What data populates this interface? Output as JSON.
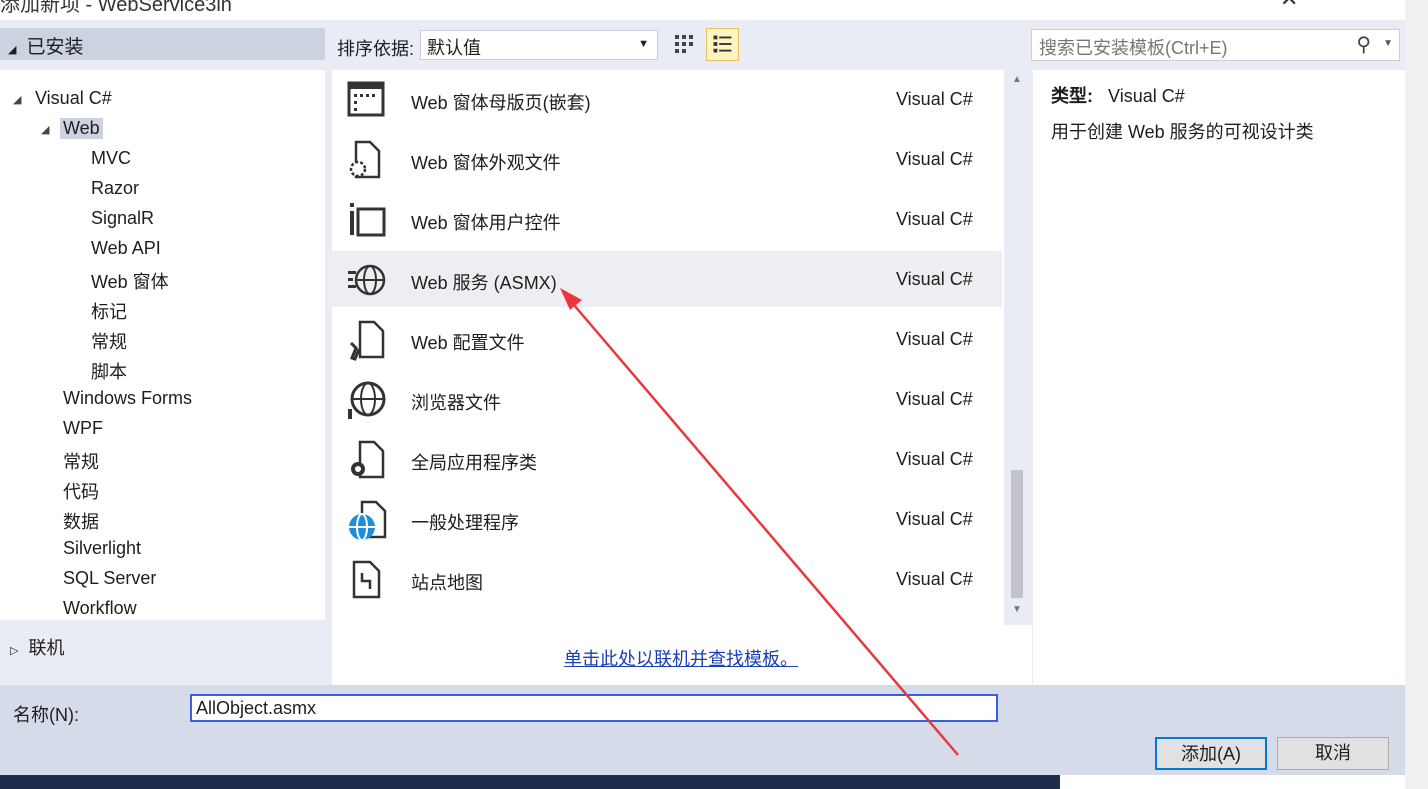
{
  "window": {
    "title": "添加新项 - WebService3in",
    "close": "✕"
  },
  "sidebar": {
    "installed": "已安装",
    "online": "联机",
    "tree": [
      {
        "label": "Visual C#",
        "level": 0,
        "expanded": true
      },
      {
        "label": "Web",
        "level": 1,
        "expanded": true,
        "selected": true
      },
      {
        "label": "MVC",
        "level": 2
      },
      {
        "label": "Razor",
        "level": 2
      },
      {
        "label": "SignalR",
        "level": 2
      },
      {
        "label": "Web API",
        "level": 2
      },
      {
        "label": "Web 窗体",
        "level": 2
      },
      {
        "label": "标记",
        "level": 2
      },
      {
        "label": "常规",
        "level": 2
      },
      {
        "label": "脚本",
        "level": 2
      },
      {
        "label": "Windows Forms",
        "level": 1
      },
      {
        "label": "WPF",
        "level": 1
      },
      {
        "label": "常规",
        "level": 1
      },
      {
        "label": "代码",
        "level": 1
      },
      {
        "label": "数据",
        "level": 1
      },
      {
        "label": "Silverlight",
        "level": 1
      },
      {
        "label": "SQL Server",
        "level": 1
      },
      {
        "label": "Workflow",
        "level": 1
      }
    ]
  },
  "toolbar": {
    "sort_label": "排序依据:",
    "sort_value": "默认值",
    "search_placeholder": "搜索已安装模板(Ctrl+E)"
  },
  "templates": [
    {
      "name": "Web 窗体母版页(嵌套)",
      "type": "Visual C#",
      "icon": "master-page-icon"
    },
    {
      "name": "Web 窗体外观文件",
      "type": "Visual C#",
      "icon": "skin-file-icon"
    },
    {
      "name": "Web 窗体用户控件",
      "type": "Visual C#",
      "icon": "user-control-icon"
    },
    {
      "name": "Web 服务 (ASMX)",
      "type": "Visual C#",
      "icon": "web-service-icon",
      "selected": true
    },
    {
      "name": "Web 配置文件",
      "type": "Visual C#",
      "icon": "config-file-icon"
    },
    {
      "name": "浏览器文件",
      "type": "Visual C#",
      "icon": "browser-file-icon"
    },
    {
      "name": "全局应用程序类",
      "type": "Visual C#",
      "icon": "global-class-icon"
    },
    {
      "name": "一般处理程序",
      "type": "Visual C#",
      "icon": "handler-icon"
    },
    {
      "name": "站点地图",
      "type": "Visual C#",
      "icon": "sitemap-icon"
    }
  ],
  "online_link": "单击此处以联机并查找模板。",
  "details": {
    "type_label": "类型:",
    "type_value": "Visual C#",
    "description": "用于创建 Web 服务的可视设计类"
  },
  "footer": {
    "name_label": "名称(N):",
    "name_value": "AllObject.asmx",
    "add": "添加(A)",
    "cancel": "取消"
  },
  "colors": {
    "accent": "#3c5ee0",
    "selected_row": "#eeeef2",
    "annotation_arrow": "#e8383d"
  }
}
